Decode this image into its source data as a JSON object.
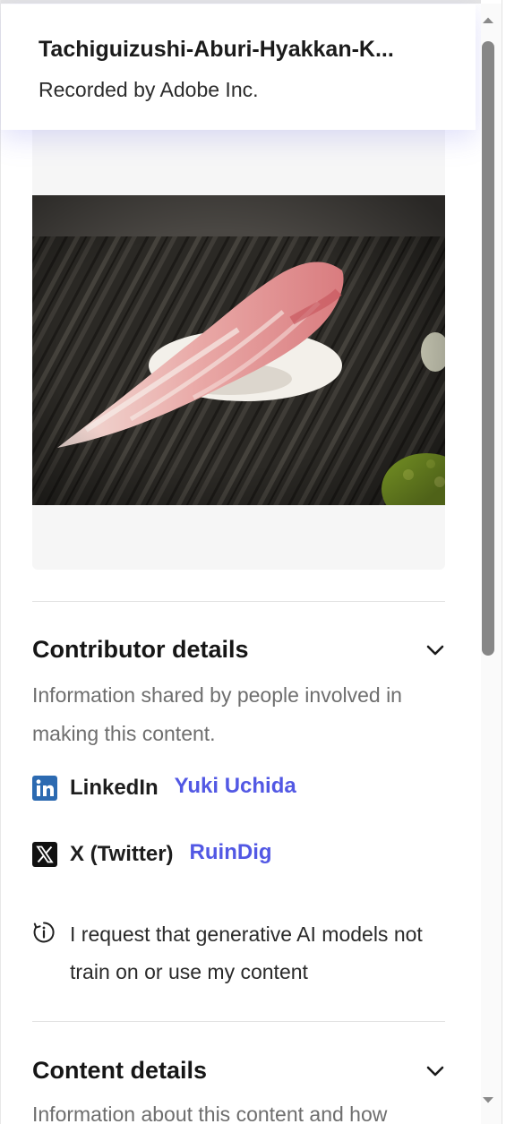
{
  "header": {
    "title": "Tachiguizushi-Aburi-Hyakkan-K...",
    "subtitle": "Recorded by Adobe Inc."
  },
  "contributor": {
    "title": "Contributor details",
    "description": "Information shared by people involved in making this content.",
    "accounts": [
      {
        "icon": "linkedin-icon",
        "platform": "LinkedIn",
        "handle": "Yuki Uchida"
      },
      {
        "icon": "x-twitter-icon",
        "platform": "X (Twitter)",
        "handle": "RuinDig"
      }
    ],
    "ai_notice": "I request that generative AI models not train on or use my content"
  },
  "content_details": {
    "title": "Content details",
    "description": "Information about this content and how"
  },
  "colors": {
    "link": "#5258e4",
    "header_shadow": "#7878e6",
    "scroll_thumb": "#878787"
  }
}
